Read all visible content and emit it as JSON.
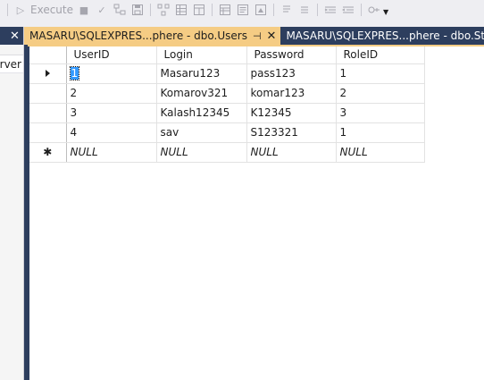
{
  "toolbar": {
    "execute_label": "Execute",
    "items": [
      "execute-icon",
      "stop-icon",
      "check-icon",
      "query-design-icon",
      "save-icon",
      "save-all-icon",
      "diagram-icon",
      "grid-icon",
      "table-icon",
      "results-icon",
      "text-results-icon",
      "comment-icon",
      "indent-icon",
      "outdent-icon",
      "options-icon"
    ]
  },
  "left_panel": {
    "close_glyph": "✕",
    "row_text": "rver"
  },
  "tabs": [
    {
      "label": "MASARU\\SQLEXPRES...phere - dbo.Users",
      "active": true,
      "pin_glyph": "⊣",
      "close_glyph": "✕"
    },
    {
      "label": "MASARU\\SQLEXPRES...phere - dbo.Staff",
      "active": false
    }
  ],
  "grid": {
    "columns": [
      "UserID",
      "Login",
      "Password",
      "RoleID"
    ],
    "rows": [
      {
        "UserID": "1",
        "Login": "Masaru123",
        "Password": "pass123",
        "RoleID": "1",
        "marker": "current"
      },
      {
        "UserID": "2",
        "Login": "Komarov321",
        "Password": "komar123",
        "RoleID": "2",
        "marker": ""
      },
      {
        "UserID": "3",
        "Login": "Kalash12345",
        "Password": "K12345",
        "RoleID": "3",
        "marker": ""
      },
      {
        "UserID": "4",
        "Login": "sav",
        "Password": "S123321",
        "RoleID": "1",
        "marker": ""
      },
      {
        "UserID": "NULL",
        "Login": "NULL",
        "Password": "NULL",
        "RoleID": "NULL",
        "marker": "new"
      }
    ],
    "new_row_glyph": "✱"
  },
  "colors": {
    "active_tab": "#f5cc84",
    "frame": "#2d3e5e",
    "selection": "#3399ff"
  }
}
